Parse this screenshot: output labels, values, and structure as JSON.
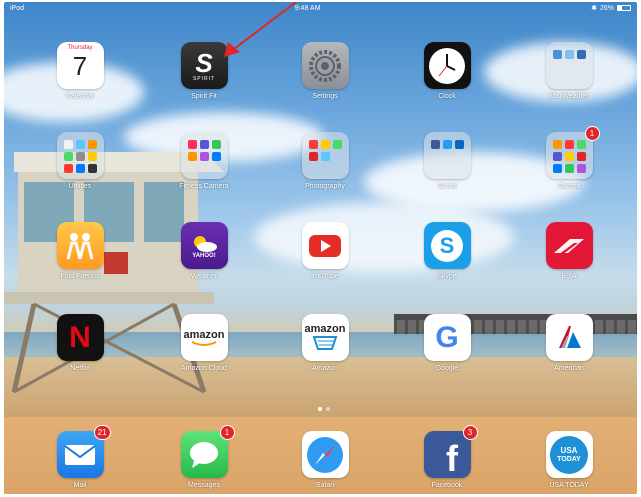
{
  "status_bar": {
    "carrier": "iPod",
    "time": "9:48 AM",
    "battery": "26%"
  },
  "apps": [
    {
      "id": "calendar",
      "label": "Calendar",
      "day": "Thursday",
      "date": "7"
    },
    {
      "id": "spirit-fit",
      "label": "Spirit Fit",
      "glyph": "S",
      "brand": "SPIRIT"
    },
    {
      "id": "settings",
      "label": "Settings"
    },
    {
      "id": "clock",
      "label": "Clock"
    },
    {
      "id": "maxweather",
      "label": "MaxWeather"
    },
    {
      "id": "utilities",
      "label": "Utilities"
    },
    {
      "id": "fitness-camera",
      "label": "Fitness Camera"
    },
    {
      "id": "photography",
      "label": "Photography"
    },
    {
      "id": "social",
      "label": "Social"
    },
    {
      "id": "games",
      "label": "Games",
      "badge": "1"
    },
    {
      "id": "find-friends",
      "label": "Find Friends"
    },
    {
      "id": "yahoo-weather",
      "label": "Weather",
      "brand": "YAHOO!"
    },
    {
      "id": "youtube",
      "label": "YouTube"
    },
    {
      "id": "skype",
      "label": "Skype"
    },
    {
      "id": "bofa",
      "label": "BofA"
    },
    {
      "id": "netflix",
      "label": "Netflix",
      "glyph": "N"
    },
    {
      "id": "amazon-cloud",
      "label": "Amazon Cloud",
      "brand": "amazon"
    },
    {
      "id": "amazon",
      "label": "Amazon",
      "brand": "amazon"
    },
    {
      "id": "google",
      "label": "Google",
      "glyph": "G"
    },
    {
      "id": "american",
      "label": "American"
    }
  ],
  "dock": [
    {
      "id": "mail",
      "label": "Mail",
      "badge": "21"
    },
    {
      "id": "messages",
      "label": "Messages",
      "badge": "1"
    },
    {
      "id": "safari",
      "label": "Safari"
    },
    {
      "id": "facebook",
      "label": "Facebook",
      "badge": "3",
      "glyph": "f"
    },
    {
      "id": "usa-today",
      "label": "USA TODAY",
      "brand_line1": "USA",
      "brand_line2": "TODAY"
    }
  ],
  "colors": {
    "annotation_arrow": "#e0262b",
    "badge": "#e0262b",
    "youtube": "#e52d27",
    "skype": "#1aa0e8",
    "bofa": "#e31837",
    "netflix_bg": "#111111",
    "messages": "#34c759",
    "facebook": "#3b5998",
    "usa_today": "#1f8fd6"
  }
}
